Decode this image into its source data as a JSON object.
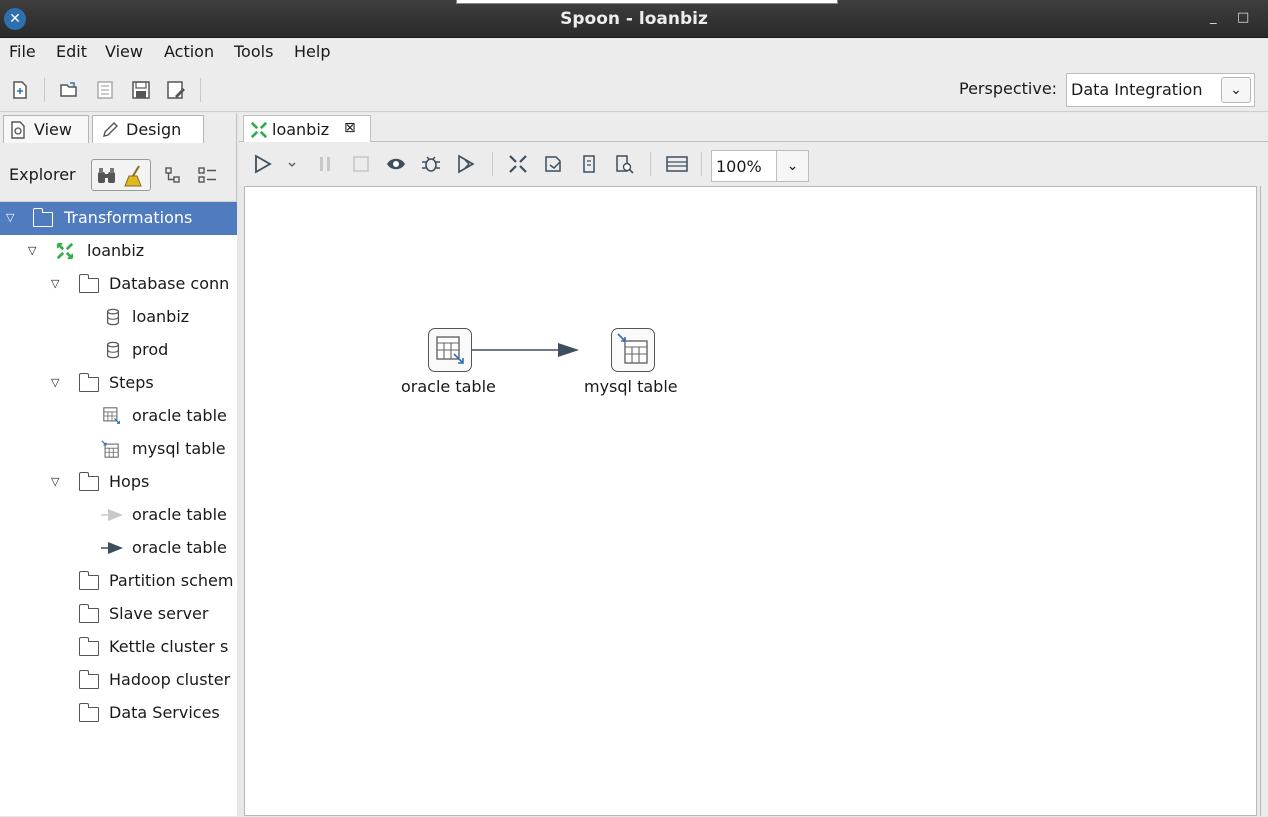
{
  "window": {
    "title": "Spoon - loanbiz",
    "minimize": "_",
    "maximize": "□"
  },
  "menu": [
    "File",
    "Edit",
    "View",
    "Action",
    "Tools",
    "Help"
  ],
  "toolbar": {
    "perspective_label": "Perspective:",
    "perspective_value": "Data Integration",
    "icons": [
      "new-file-icon",
      "open-icon",
      "explore-repository-icon",
      "save-icon",
      "save-as-icon"
    ]
  },
  "left_panel": {
    "tabs": {
      "view": "View",
      "design": "Design"
    },
    "explorer_label": "Explorer",
    "tree": [
      {
        "label": "Transformations",
        "depth": 0,
        "icon": "folder",
        "expanded": true,
        "selected": true
      },
      {
        "label": "loanbiz",
        "depth": 1,
        "icon": "transformation",
        "expanded": true
      },
      {
        "label": "Database conn",
        "depth": 2,
        "icon": "folder",
        "expanded": true
      },
      {
        "label": "loanbiz",
        "depth": 3,
        "icon": "database"
      },
      {
        "label": "prod",
        "depth": 3,
        "icon": "database"
      },
      {
        "label": "Steps",
        "depth": 2,
        "icon": "folder",
        "expanded": true
      },
      {
        "label": "oracle table",
        "depth": 3,
        "icon": "table-input"
      },
      {
        "label": "mysql table",
        "depth": 3,
        "icon": "table-output"
      },
      {
        "label": "Hops",
        "depth": 2,
        "icon": "folder",
        "expanded": true
      },
      {
        "label": "oracle table",
        "depth": 3,
        "icon": "hop-disabled"
      },
      {
        "label": "oracle table",
        "depth": 3,
        "icon": "hop"
      },
      {
        "label": "Partition schem",
        "depth": 2,
        "icon": "folder"
      },
      {
        "label": "Slave server",
        "depth": 2,
        "icon": "folder"
      },
      {
        "label": "Kettle cluster s",
        "depth": 2,
        "icon": "folder"
      },
      {
        "label": "Hadoop cluster",
        "depth": 2,
        "icon": "folder"
      },
      {
        "label": "Data Services",
        "depth": 2,
        "icon": "folder"
      }
    ]
  },
  "editor": {
    "tab_label": "loanbiz",
    "tab_close": "⊠",
    "zoom": "100%",
    "steps": [
      {
        "name": "oracle table",
        "type": "table-input"
      },
      {
        "name": "mysql table",
        "type": "table-output"
      }
    ],
    "hops": [
      {
        "from": "oracle table",
        "to": "mysql table"
      }
    ]
  }
}
